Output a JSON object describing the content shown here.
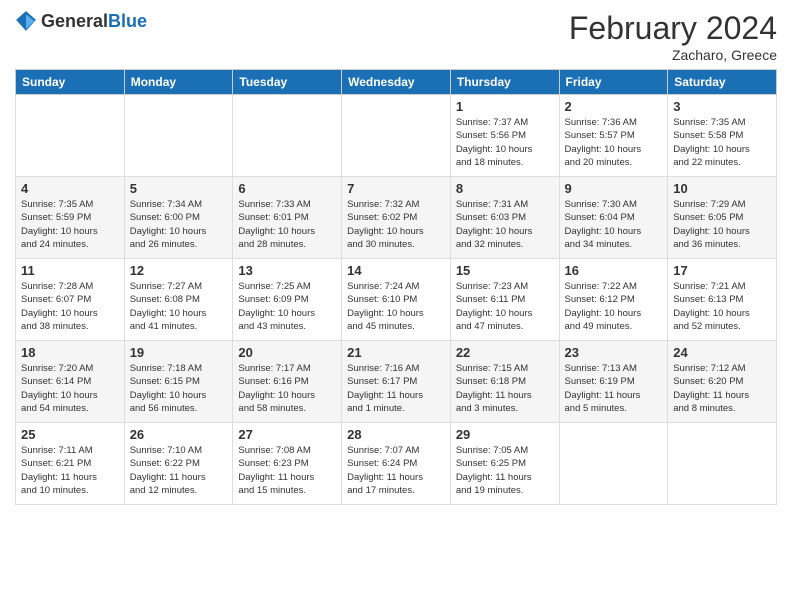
{
  "header": {
    "logo_general": "General",
    "logo_blue": "Blue",
    "title": "February 2024",
    "subtitle": "Zacharo, Greece"
  },
  "days_of_week": [
    "Sunday",
    "Monday",
    "Tuesday",
    "Wednesday",
    "Thursday",
    "Friday",
    "Saturday"
  ],
  "weeks": [
    [
      {
        "day": "",
        "info": ""
      },
      {
        "day": "",
        "info": ""
      },
      {
        "day": "",
        "info": ""
      },
      {
        "day": "",
        "info": ""
      },
      {
        "day": "1",
        "info": "Sunrise: 7:37 AM\nSunset: 5:56 PM\nDaylight: 10 hours\nand 18 minutes."
      },
      {
        "day": "2",
        "info": "Sunrise: 7:36 AM\nSunset: 5:57 PM\nDaylight: 10 hours\nand 20 minutes."
      },
      {
        "day": "3",
        "info": "Sunrise: 7:35 AM\nSunset: 5:58 PM\nDaylight: 10 hours\nand 22 minutes."
      }
    ],
    [
      {
        "day": "4",
        "info": "Sunrise: 7:35 AM\nSunset: 5:59 PM\nDaylight: 10 hours\nand 24 minutes."
      },
      {
        "day": "5",
        "info": "Sunrise: 7:34 AM\nSunset: 6:00 PM\nDaylight: 10 hours\nand 26 minutes."
      },
      {
        "day": "6",
        "info": "Sunrise: 7:33 AM\nSunset: 6:01 PM\nDaylight: 10 hours\nand 28 minutes."
      },
      {
        "day": "7",
        "info": "Sunrise: 7:32 AM\nSunset: 6:02 PM\nDaylight: 10 hours\nand 30 minutes."
      },
      {
        "day": "8",
        "info": "Sunrise: 7:31 AM\nSunset: 6:03 PM\nDaylight: 10 hours\nand 32 minutes."
      },
      {
        "day": "9",
        "info": "Sunrise: 7:30 AM\nSunset: 6:04 PM\nDaylight: 10 hours\nand 34 minutes."
      },
      {
        "day": "10",
        "info": "Sunrise: 7:29 AM\nSunset: 6:05 PM\nDaylight: 10 hours\nand 36 minutes."
      }
    ],
    [
      {
        "day": "11",
        "info": "Sunrise: 7:28 AM\nSunset: 6:07 PM\nDaylight: 10 hours\nand 38 minutes."
      },
      {
        "day": "12",
        "info": "Sunrise: 7:27 AM\nSunset: 6:08 PM\nDaylight: 10 hours\nand 41 minutes."
      },
      {
        "day": "13",
        "info": "Sunrise: 7:25 AM\nSunset: 6:09 PM\nDaylight: 10 hours\nand 43 minutes."
      },
      {
        "day": "14",
        "info": "Sunrise: 7:24 AM\nSunset: 6:10 PM\nDaylight: 10 hours\nand 45 minutes."
      },
      {
        "day": "15",
        "info": "Sunrise: 7:23 AM\nSunset: 6:11 PM\nDaylight: 10 hours\nand 47 minutes."
      },
      {
        "day": "16",
        "info": "Sunrise: 7:22 AM\nSunset: 6:12 PM\nDaylight: 10 hours\nand 49 minutes."
      },
      {
        "day": "17",
        "info": "Sunrise: 7:21 AM\nSunset: 6:13 PM\nDaylight: 10 hours\nand 52 minutes."
      }
    ],
    [
      {
        "day": "18",
        "info": "Sunrise: 7:20 AM\nSunset: 6:14 PM\nDaylight: 10 hours\nand 54 minutes."
      },
      {
        "day": "19",
        "info": "Sunrise: 7:18 AM\nSunset: 6:15 PM\nDaylight: 10 hours\nand 56 minutes."
      },
      {
        "day": "20",
        "info": "Sunrise: 7:17 AM\nSunset: 6:16 PM\nDaylight: 10 hours\nand 58 minutes."
      },
      {
        "day": "21",
        "info": "Sunrise: 7:16 AM\nSunset: 6:17 PM\nDaylight: 11 hours\nand 1 minute."
      },
      {
        "day": "22",
        "info": "Sunrise: 7:15 AM\nSunset: 6:18 PM\nDaylight: 11 hours\nand 3 minutes."
      },
      {
        "day": "23",
        "info": "Sunrise: 7:13 AM\nSunset: 6:19 PM\nDaylight: 11 hours\nand 5 minutes."
      },
      {
        "day": "24",
        "info": "Sunrise: 7:12 AM\nSunset: 6:20 PM\nDaylight: 11 hours\nand 8 minutes."
      }
    ],
    [
      {
        "day": "25",
        "info": "Sunrise: 7:11 AM\nSunset: 6:21 PM\nDaylight: 11 hours\nand 10 minutes."
      },
      {
        "day": "26",
        "info": "Sunrise: 7:10 AM\nSunset: 6:22 PM\nDaylight: 11 hours\nand 12 minutes."
      },
      {
        "day": "27",
        "info": "Sunrise: 7:08 AM\nSunset: 6:23 PM\nDaylight: 11 hours\nand 15 minutes."
      },
      {
        "day": "28",
        "info": "Sunrise: 7:07 AM\nSunset: 6:24 PM\nDaylight: 11 hours\nand 17 minutes."
      },
      {
        "day": "29",
        "info": "Sunrise: 7:05 AM\nSunset: 6:25 PM\nDaylight: 11 hours\nand 19 minutes."
      },
      {
        "day": "",
        "info": ""
      },
      {
        "day": "",
        "info": ""
      }
    ]
  ]
}
